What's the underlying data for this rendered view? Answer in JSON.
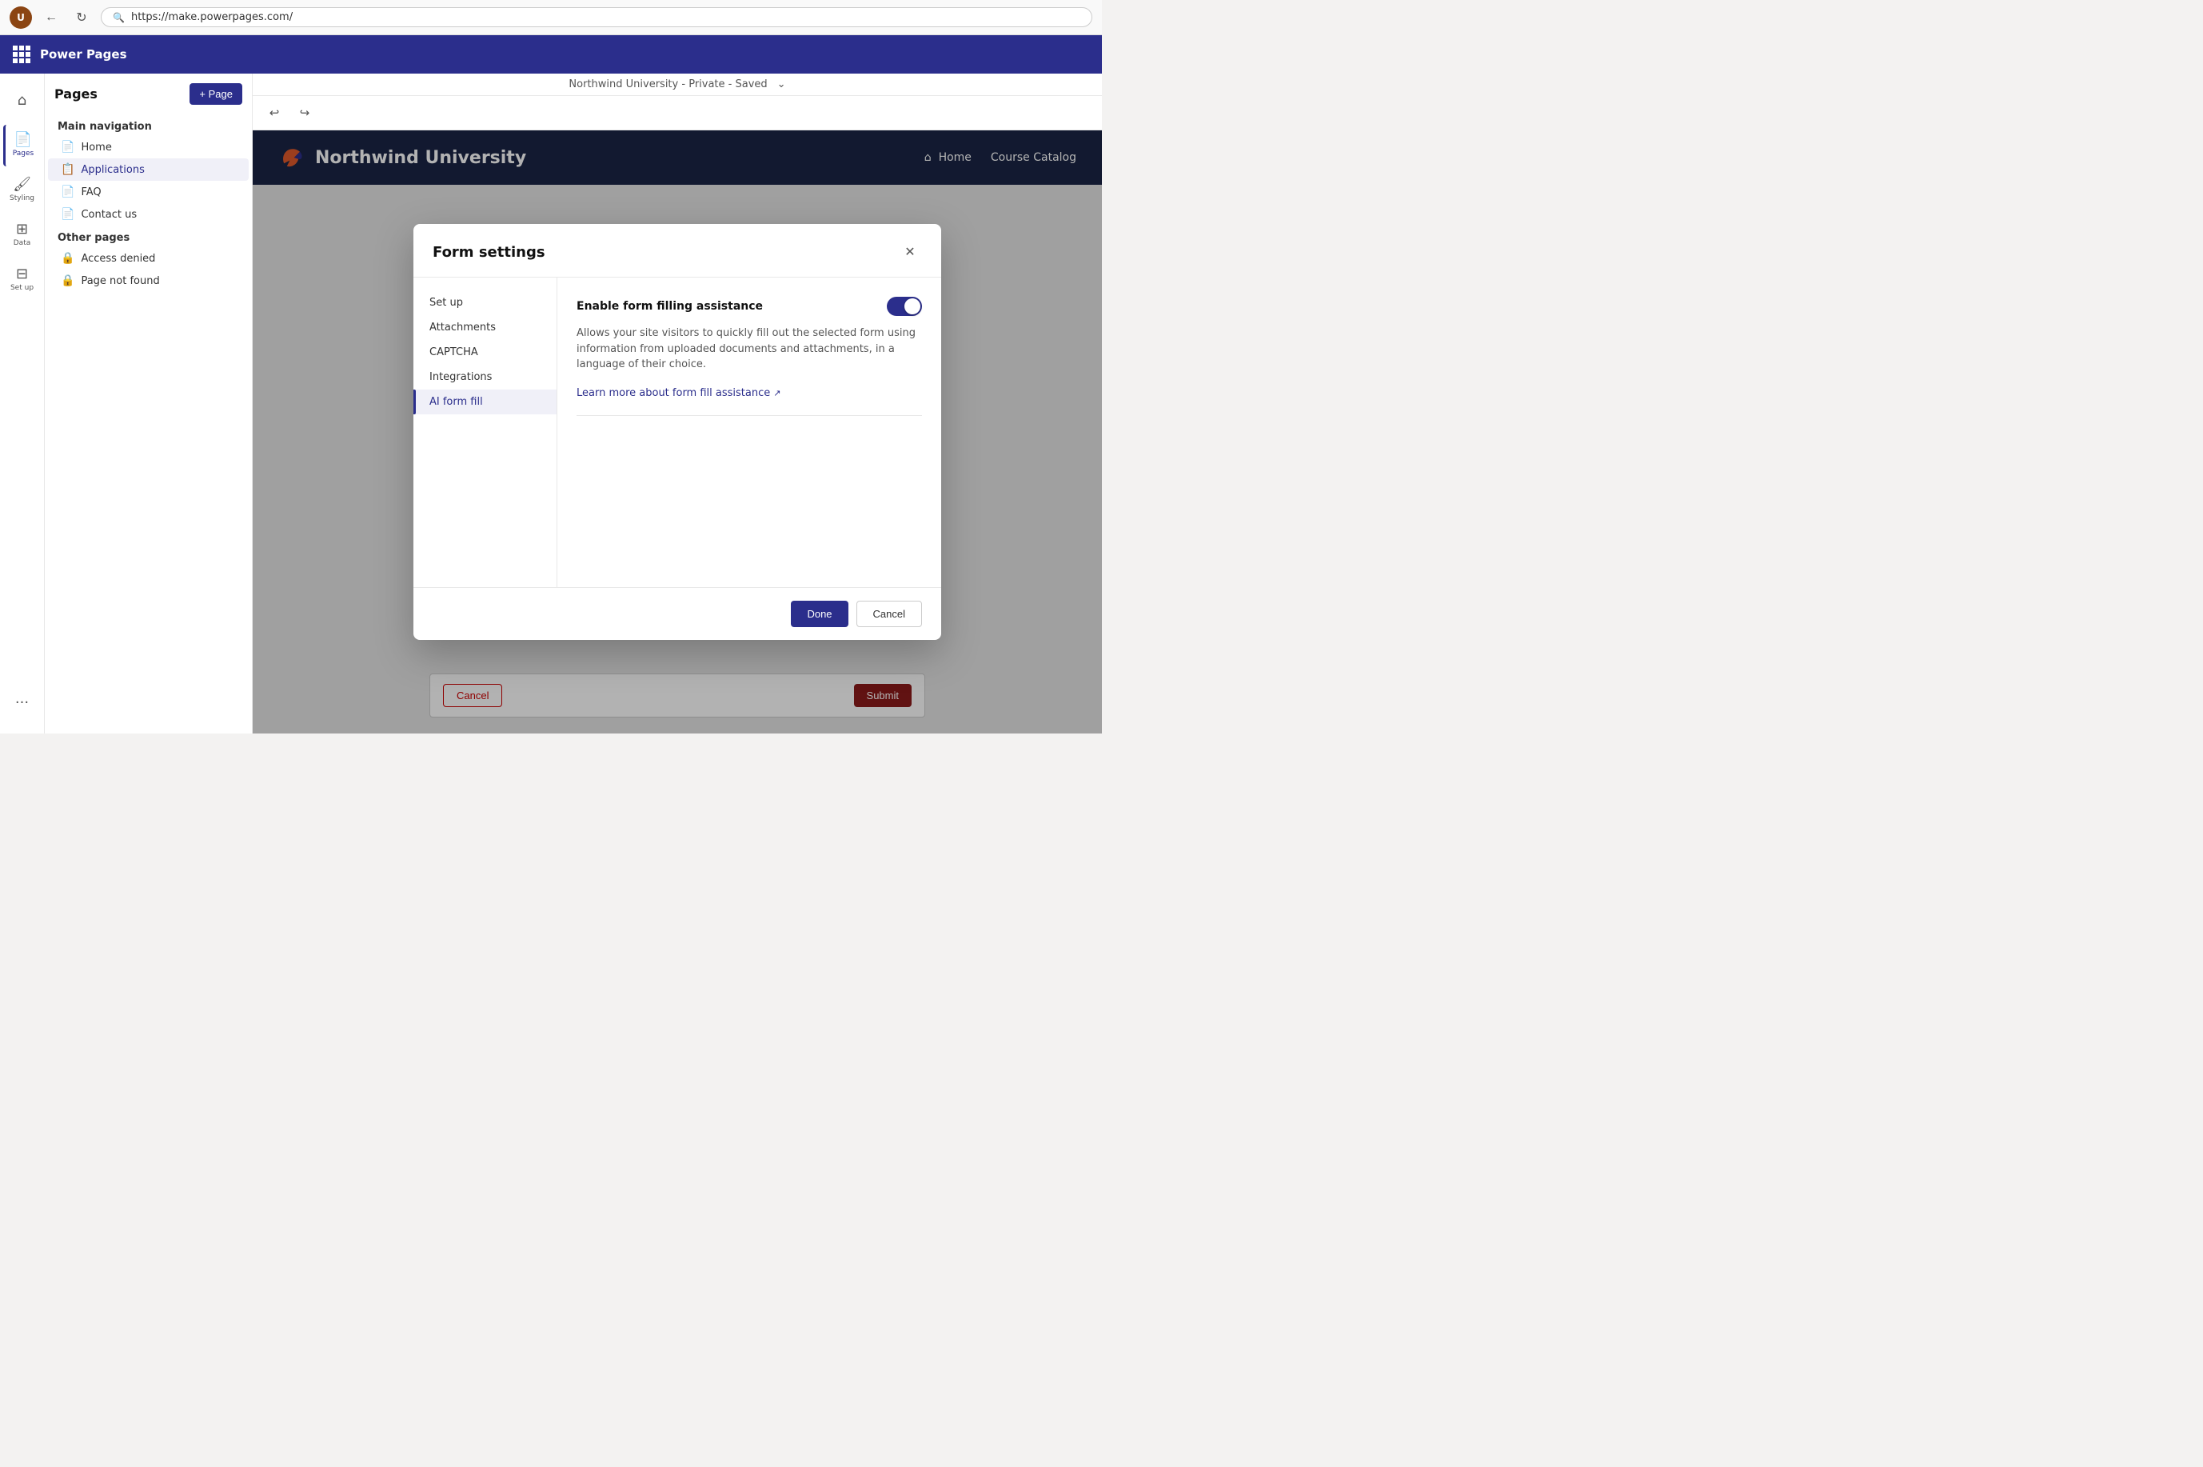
{
  "browser": {
    "url": "https://make.powerpages.com/",
    "back_title": "Back",
    "refresh_title": "Refresh"
  },
  "app": {
    "title": "Power Pages"
  },
  "topbar": {
    "site_name": "Northwind University",
    "site_visibility": "Private",
    "site_saved": "Saved"
  },
  "sidebar_icons": [
    {
      "id": "home",
      "label": "Home",
      "icon": "⌂"
    },
    {
      "id": "pages",
      "label": "Pages",
      "icon": "📄",
      "active": true
    },
    {
      "id": "styling",
      "label": "Styling",
      "icon": "🎨"
    },
    {
      "id": "data",
      "label": "Data",
      "icon": "⊞"
    },
    {
      "id": "setup",
      "label": "Set up",
      "icon": "⊟"
    },
    {
      "id": "more",
      "label": "...",
      "icon": "···"
    }
  ],
  "pages_panel": {
    "title": "Pages",
    "add_button_label": "+ Page",
    "main_nav_title": "Main navigation",
    "main_nav_items": [
      {
        "label": "Home",
        "icon": "📄",
        "active": false
      },
      {
        "label": "Applications",
        "icon": "📋",
        "active": true
      },
      {
        "label": "FAQ",
        "icon": "📄",
        "active": false
      },
      {
        "label": "Contact us",
        "icon": "📄",
        "active": false
      }
    ],
    "other_pages_title": "Other pages",
    "other_pages_items": [
      {
        "label": "Access denied",
        "icon": "🔒"
      },
      {
        "label": "Page not found",
        "icon": "🔒"
      }
    ]
  },
  "canvas_toolbar": {
    "undo_label": "Undo",
    "redo_label": "Redo"
  },
  "site_preview": {
    "university_name": "Northwind University",
    "nav_home": "Home",
    "nav_catalog": "Course Catalog"
  },
  "modal": {
    "title": "Form settings",
    "close_label": "Close",
    "nav_items": [
      {
        "label": "Set up",
        "active": false
      },
      {
        "label": "Attachments",
        "active": false
      },
      {
        "label": "CAPTCHA",
        "active": false
      },
      {
        "label": "Integrations",
        "active": false
      },
      {
        "label": "AI form fill",
        "active": true
      }
    ],
    "ai_form_fill": {
      "toggle_label": "Enable form filling assistance",
      "toggle_enabled": true,
      "description": "Allows your site visitors to quickly fill out the selected form using information from uploaded documents and attachments, in a language of their choice.",
      "learn_more_text": "Learn more about form fill assistance",
      "learn_more_icon": "↗"
    },
    "done_button": "Done",
    "cancel_button": "Cancel"
  },
  "form_buttons": {
    "cancel_label": "Cancel",
    "submit_label": "Submit"
  }
}
